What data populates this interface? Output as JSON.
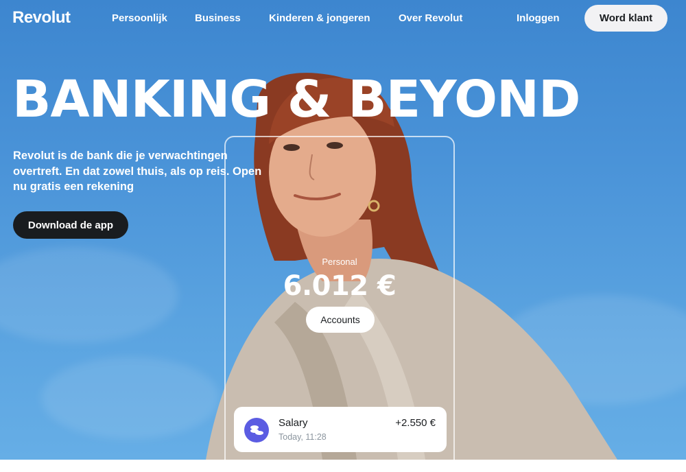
{
  "brand": {
    "logo_text": "Revolut"
  },
  "nav": {
    "links": [
      "Persoonlijk",
      "Business",
      "Kinderen & jongeren",
      "Over Revolut"
    ],
    "login_label": "Inloggen",
    "cta_label": "Word klant"
  },
  "hero": {
    "title": "BANKING & BEYOND",
    "subtitle": "Revolut is de bank die je verwachtingen overtreft. En dat zowel thuis, als op reis. Open nu gratis een rekening",
    "download_label": "Download de app"
  },
  "account": {
    "label": "Personal",
    "balance": "6.012 €",
    "accounts_label": "Accounts"
  },
  "transaction": {
    "name": "Salary",
    "time": "Today, 11:28",
    "amount": "+2.550 €"
  },
  "colors": {
    "sky": "#4a93d8",
    "dark": "#191c1f",
    "light_button": "#f2f2f4",
    "tx_icon": "#5b5ce2"
  }
}
